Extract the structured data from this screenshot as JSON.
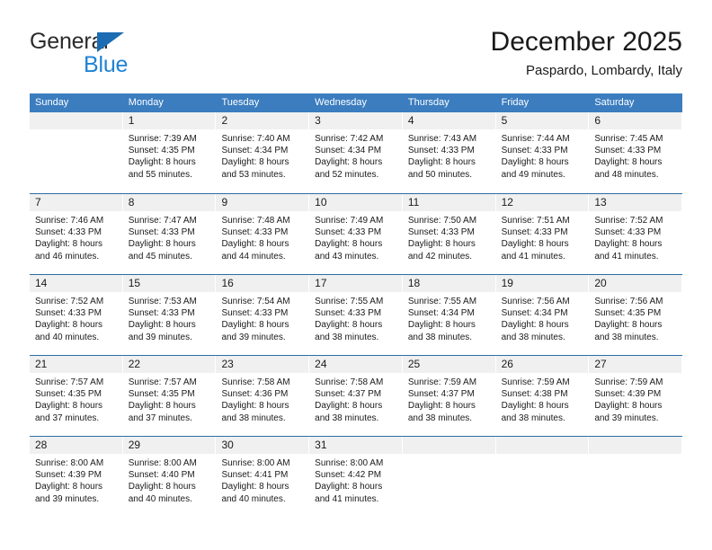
{
  "logo": {
    "text_primary": "General",
    "text_secondary": "Blue",
    "triangle_color": "#1b6cb3",
    "primary_color": "#2b2b2b",
    "secondary_color": "#1f83d4"
  },
  "header": {
    "title": "December 2025",
    "location": "Paspardo, Lombardy, Italy"
  },
  "theme": {
    "header_bg": "#3b7dbf",
    "header_text": "#ffffff",
    "day_band_bg": "#f0f0f0",
    "row_divider": "#2e6da4",
    "cell_bg": "#ffffff",
    "body_text": "#1a1a1a"
  },
  "weekdays": [
    "Sunday",
    "Monday",
    "Tuesday",
    "Wednesday",
    "Thursday",
    "Friday",
    "Saturday"
  ],
  "weeks": [
    [
      {
        "day": "",
        "sunrise": "",
        "sunset": "",
        "daylight_line1": "",
        "daylight_line2": ""
      },
      {
        "day": "1",
        "sunrise": "Sunrise: 7:39 AM",
        "sunset": "Sunset: 4:35 PM",
        "daylight_line1": "Daylight: 8 hours",
        "daylight_line2": "and 55 minutes."
      },
      {
        "day": "2",
        "sunrise": "Sunrise: 7:40 AM",
        "sunset": "Sunset: 4:34 PM",
        "daylight_line1": "Daylight: 8 hours",
        "daylight_line2": "and 53 minutes."
      },
      {
        "day": "3",
        "sunrise": "Sunrise: 7:42 AM",
        "sunset": "Sunset: 4:34 PM",
        "daylight_line1": "Daylight: 8 hours",
        "daylight_line2": "and 52 minutes."
      },
      {
        "day": "4",
        "sunrise": "Sunrise: 7:43 AM",
        "sunset": "Sunset: 4:33 PM",
        "daylight_line1": "Daylight: 8 hours",
        "daylight_line2": "and 50 minutes."
      },
      {
        "day": "5",
        "sunrise": "Sunrise: 7:44 AM",
        "sunset": "Sunset: 4:33 PM",
        "daylight_line1": "Daylight: 8 hours",
        "daylight_line2": "and 49 minutes."
      },
      {
        "day": "6",
        "sunrise": "Sunrise: 7:45 AM",
        "sunset": "Sunset: 4:33 PM",
        "daylight_line1": "Daylight: 8 hours",
        "daylight_line2": "and 48 minutes."
      }
    ],
    [
      {
        "day": "7",
        "sunrise": "Sunrise: 7:46 AM",
        "sunset": "Sunset: 4:33 PM",
        "daylight_line1": "Daylight: 8 hours",
        "daylight_line2": "and 46 minutes."
      },
      {
        "day": "8",
        "sunrise": "Sunrise: 7:47 AM",
        "sunset": "Sunset: 4:33 PM",
        "daylight_line1": "Daylight: 8 hours",
        "daylight_line2": "and 45 minutes."
      },
      {
        "day": "9",
        "sunrise": "Sunrise: 7:48 AM",
        "sunset": "Sunset: 4:33 PM",
        "daylight_line1": "Daylight: 8 hours",
        "daylight_line2": "and 44 minutes."
      },
      {
        "day": "10",
        "sunrise": "Sunrise: 7:49 AM",
        "sunset": "Sunset: 4:33 PM",
        "daylight_line1": "Daylight: 8 hours",
        "daylight_line2": "and 43 minutes."
      },
      {
        "day": "11",
        "sunrise": "Sunrise: 7:50 AM",
        "sunset": "Sunset: 4:33 PM",
        "daylight_line1": "Daylight: 8 hours",
        "daylight_line2": "and 42 minutes."
      },
      {
        "day": "12",
        "sunrise": "Sunrise: 7:51 AM",
        "sunset": "Sunset: 4:33 PM",
        "daylight_line1": "Daylight: 8 hours",
        "daylight_line2": "and 41 minutes."
      },
      {
        "day": "13",
        "sunrise": "Sunrise: 7:52 AM",
        "sunset": "Sunset: 4:33 PM",
        "daylight_line1": "Daylight: 8 hours",
        "daylight_line2": "and 41 minutes."
      }
    ],
    [
      {
        "day": "14",
        "sunrise": "Sunrise: 7:52 AM",
        "sunset": "Sunset: 4:33 PM",
        "daylight_line1": "Daylight: 8 hours",
        "daylight_line2": "and 40 minutes."
      },
      {
        "day": "15",
        "sunrise": "Sunrise: 7:53 AM",
        "sunset": "Sunset: 4:33 PM",
        "daylight_line1": "Daylight: 8 hours",
        "daylight_line2": "and 39 minutes."
      },
      {
        "day": "16",
        "sunrise": "Sunrise: 7:54 AM",
        "sunset": "Sunset: 4:33 PM",
        "daylight_line1": "Daylight: 8 hours",
        "daylight_line2": "and 39 minutes."
      },
      {
        "day": "17",
        "sunrise": "Sunrise: 7:55 AM",
        "sunset": "Sunset: 4:33 PM",
        "daylight_line1": "Daylight: 8 hours",
        "daylight_line2": "and 38 minutes."
      },
      {
        "day": "18",
        "sunrise": "Sunrise: 7:55 AM",
        "sunset": "Sunset: 4:34 PM",
        "daylight_line1": "Daylight: 8 hours",
        "daylight_line2": "and 38 minutes."
      },
      {
        "day": "19",
        "sunrise": "Sunrise: 7:56 AM",
        "sunset": "Sunset: 4:34 PM",
        "daylight_line1": "Daylight: 8 hours",
        "daylight_line2": "and 38 minutes."
      },
      {
        "day": "20",
        "sunrise": "Sunrise: 7:56 AM",
        "sunset": "Sunset: 4:35 PM",
        "daylight_line1": "Daylight: 8 hours",
        "daylight_line2": "and 38 minutes."
      }
    ],
    [
      {
        "day": "21",
        "sunrise": "Sunrise: 7:57 AM",
        "sunset": "Sunset: 4:35 PM",
        "daylight_line1": "Daylight: 8 hours",
        "daylight_line2": "and 37 minutes."
      },
      {
        "day": "22",
        "sunrise": "Sunrise: 7:57 AM",
        "sunset": "Sunset: 4:35 PM",
        "daylight_line1": "Daylight: 8 hours",
        "daylight_line2": "and 37 minutes."
      },
      {
        "day": "23",
        "sunrise": "Sunrise: 7:58 AM",
        "sunset": "Sunset: 4:36 PM",
        "daylight_line1": "Daylight: 8 hours",
        "daylight_line2": "and 38 minutes."
      },
      {
        "day": "24",
        "sunrise": "Sunrise: 7:58 AM",
        "sunset": "Sunset: 4:37 PM",
        "daylight_line1": "Daylight: 8 hours",
        "daylight_line2": "and 38 minutes."
      },
      {
        "day": "25",
        "sunrise": "Sunrise: 7:59 AM",
        "sunset": "Sunset: 4:37 PM",
        "daylight_line1": "Daylight: 8 hours",
        "daylight_line2": "and 38 minutes."
      },
      {
        "day": "26",
        "sunrise": "Sunrise: 7:59 AM",
        "sunset": "Sunset: 4:38 PM",
        "daylight_line1": "Daylight: 8 hours",
        "daylight_line2": "and 38 minutes."
      },
      {
        "day": "27",
        "sunrise": "Sunrise: 7:59 AM",
        "sunset": "Sunset: 4:39 PM",
        "daylight_line1": "Daylight: 8 hours",
        "daylight_line2": "and 39 minutes."
      }
    ],
    [
      {
        "day": "28",
        "sunrise": "Sunrise: 8:00 AM",
        "sunset": "Sunset: 4:39 PM",
        "daylight_line1": "Daylight: 8 hours",
        "daylight_line2": "and 39 minutes."
      },
      {
        "day": "29",
        "sunrise": "Sunrise: 8:00 AM",
        "sunset": "Sunset: 4:40 PM",
        "daylight_line1": "Daylight: 8 hours",
        "daylight_line2": "and 40 minutes."
      },
      {
        "day": "30",
        "sunrise": "Sunrise: 8:00 AM",
        "sunset": "Sunset: 4:41 PM",
        "daylight_line1": "Daylight: 8 hours",
        "daylight_line2": "and 40 minutes."
      },
      {
        "day": "31",
        "sunrise": "Sunrise: 8:00 AM",
        "sunset": "Sunset: 4:42 PM",
        "daylight_line1": "Daylight: 8 hours",
        "daylight_line2": "and 41 minutes."
      },
      {
        "day": "",
        "sunrise": "",
        "sunset": "",
        "daylight_line1": "",
        "daylight_line2": ""
      },
      {
        "day": "",
        "sunrise": "",
        "sunset": "",
        "daylight_line1": "",
        "daylight_line2": ""
      },
      {
        "day": "",
        "sunrise": "",
        "sunset": "",
        "daylight_line1": "",
        "daylight_line2": ""
      }
    ]
  ]
}
